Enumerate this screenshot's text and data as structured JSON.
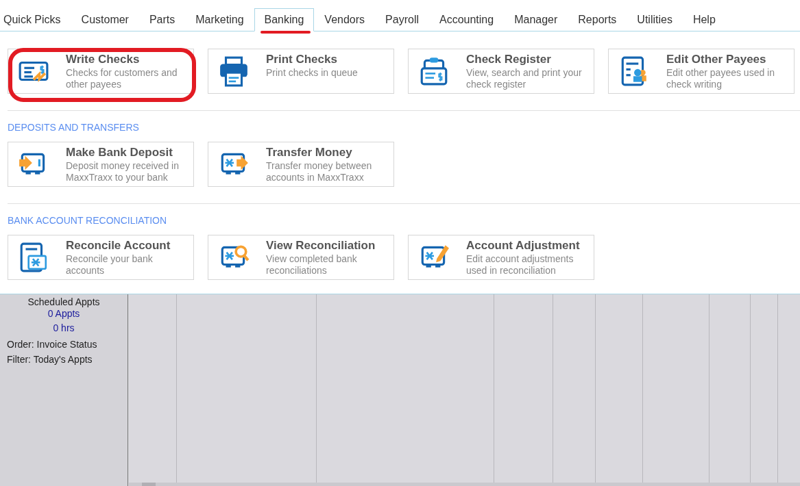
{
  "menu_tabs": [
    {
      "label": "Quick Picks",
      "selected": false,
      "underlined": false
    },
    {
      "label": "Customer",
      "selected": false,
      "underlined": false
    },
    {
      "label": "Parts",
      "selected": false,
      "underlined": false
    },
    {
      "label": "Marketing",
      "selected": false,
      "underlined": false
    },
    {
      "label": "Banking",
      "selected": true,
      "underlined": true
    },
    {
      "label": "Vendors",
      "selected": false,
      "underlined": false
    },
    {
      "label": "Payroll",
      "selected": false,
      "underlined": false
    },
    {
      "label": "Accounting",
      "selected": false,
      "underlined": false
    },
    {
      "label": "Manager",
      "selected": false,
      "underlined": false
    },
    {
      "label": "Reports",
      "selected": false,
      "underlined": false
    },
    {
      "label": "Utilities",
      "selected": false,
      "underlined": false
    },
    {
      "label": "Help",
      "selected": false,
      "underlined": false
    }
  ],
  "sections": [
    {
      "items": [
        {
          "title": "Write Checks",
          "description": "Checks for customers and other payees",
          "circled": true
        },
        {
          "title": "Print Checks",
          "description": "Print checks in queue",
          "circled": false
        },
        {
          "title": "Check Register",
          "description": "View, search and print your check register",
          "circled": false
        },
        {
          "title": "Edit Other Payees",
          "description": "Edit other payees used in check writing",
          "circled": false
        }
      ]
    },
    {
      "heading": "DEPOSITS AND TRANSFERS",
      "items": [
        {
          "title": "Make Bank Deposit",
          "description": "Deposit money received in MaxxTraxx to your bank",
          "circled": false
        },
        {
          "title": "Transfer Money",
          "description": "Transfer money between accounts in MaxxTraxx",
          "circled": false
        }
      ]
    },
    {
      "heading": "BANK ACCOUNT RECONCILIATION",
      "items": [
        {
          "title": "Reconcile Account",
          "description": "Reconcile your bank accounts",
          "circled": false
        },
        {
          "title": "View Reconciliation",
          "description": "View completed bank reconciliations",
          "circled": false
        },
        {
          "title": "Account Adjustment",
          "description": "Edit account adjustments used in reconciliation",
          "circled": false
        }
      ]
    }
  ],
  "side_panel": {
    "title": "Scheduled Appts",
    "count": "0 Appts",
    "hours": "0 hrs",
    "order": "Order: Invoice Status",
    "filter": "Filter: Today's Appts"
  }
}
